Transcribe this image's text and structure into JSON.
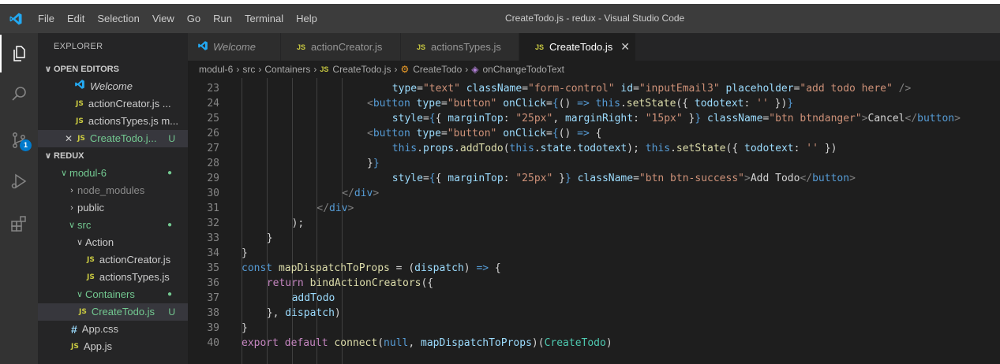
{
  "window": {
    "title": "CreateTodo.js - redux - Visual Studio Code",
    "menu": [
      "File",
      "Edit",
      "Selection",
      "View",
      "Go",
      "Run",
      "Terminal",
      "Help"
    ]
  },
  "activity_bar": {
    "items": [
      "explorer-icon",
      "search-icon",
      "source-control-icon",
      "run-debug-icon",
      "extensions-icon"
    ],
    "scm_badge": "1"
  },
  "sidebar": {
    "title": "EXPLORER",
    "open_editors_label": "OPEN EDITORS",
    "open_editors": [
      {
        "label": "Welcome"
      },
      {
        "label": "actionCreator.js ..."
      },
      {
        "label": "actionsTypes.js m..."
      },
      {
        "label": "CreateTodo.j...",
        "status": "U"
      }
    ],
    "project_label": "REDUX",
    "tree": {
      "modul6": "modul-6",
      "node_modules": "node_modules",
      "public": "public",
      "src": "src",
      "action": "Action",
      "action_creator": "actionCreator.js",
      "actions_types": "actionsTypes.js",
      "containers": "Containers",
      "create_todo": "CreateTodo.js",
      "create_todo_status": "U",
      "app_css": "App.css",
      "app_js": "App.js"
    }
  },
  "tabs": [
    {
      "label": "Welcome"
    },
    {
      "label": "actionCreator.js"
    },
    {
      "label": "actionsTypes.js"
    },
    {
      "label": "CreateTodo.js"
    }
  ],
  "breadcrumb": [
    "modul-6",
    "src",
    "Containers",
    "CreateTodo.js",
    "CreateTodo",
    "onChangeTodoText"
  ],
  "editor": {
    "lines": [
      {
        "n": "23",
        "indent": 24,
        "tokens": [
          [
            "attr",
            "type"
          ],
          [
            "txt",
            "="
          ],
          [
            "str",
            "\"text\""
          ],
          [
            "txt",
            " "
          ],
          [
            "attr",
            "className"
          ],
          [
            "txt",
            "="
          ],
          [
            "str",
            "\"form-control\""
          ],
          [
            "txt",
            " "
          ],
          [
            "attr",
            "id"
          ],
          [
            "txt",
            "="
          ],
          [
            "str",
            "\"inputEmail3\""
          ],
          [
            "txt",
            " "
          ],
          [
            "attr",
            "placeholder"
          ],
          [
            "txt",
            "="
          ],
          [
            "str",
            "\"add todo here\""
          ],
          [
            "txt",
            " "
          ],
          [
            "tag",
            "/>"
          ]
        ]
      },
      {
        "n": "24",
        "indent": 20,
        "tokens": [
          [
            "tag",
            "<"
          ],
          [
            "tn",
            "button"
          ],
          [
            "txt",
            " "
          ],
          [
            "attr",
            "type"
          ],
          [
            "txt",
            "="
          ],
          [
            "str",
            "\"button\""
          ],
          [
            "txt",
            " "
          ],
          [
            "attr",
            "onClick"
          ],
          [
            "txt",
            "="
          ],
          [
            "kw",
            "{"
          ],
          [
            "txt",
            "() "
          ],
          [
            "kw",
            "=>"
          ],
          [
            "txt",
            " "
          ],
          [
            "kw",
            "this"
          ],
          [
            "txt",
            "."
          ],
          [
            "fn",
            "setState"
          ],
          [
            "txt",
            "({ "
          ],
          [
            "var",
            "todotext"
          ],
          [
            "txt",
            ": "
          ],
          [
            "str",
            "''"
          ],
          [
            "txt",
            " })"
          ],
          [
            "kw",
            "}"
          ]
        ]
      },
      {
        "n": "25",
        "indent": 24,
        "tokens": [
          [
            "attr",
            "style"
          ],
          [
            "txt",
            "="
          ],
          [
            "kw",
            "{"
          ],
          [
            "txt",
            "{ "
          ],
          [
            "var",
            "marginTop"
          ],
          [
            "txt",
            ": "
          ],
          [
            "str",
            "\"25px\""
          ],
          [
            "txt",
            ", "
          ],
          [
            "var",
            "marginRight"
          ],
          [
            "txt",
            ": "
          ],
          [
            "str",
            "\"15px\""
          ],
          [
            "txt",
            " }"
          ],
          [
            "kw",
            "}"
          ],
          [
            "txt",
            " "
          ],
          [
            "attr",
            "className"
          ],
          [
            "txt",
            "="
          ],
          [
            "str",
            "\"btn btndanger\""
          ],
          [
            "tag",
            ">"
          ],
          [
            "txt",
            "Cancel"
          ],
          [
            "tag",
            "</"
          ],
          [
            "tn",
            "button"
          ],
          [
            "tag",
            ">"
          ]
        ]
      },
      {
        "n": "26",
        "indent": 20,
        "tokens": [
          [
            "tag",
            "<"
          ],
          [
            "tn",
            "button"
          ],
          [
            "txt",
            " "
          ],
          [
            "attr",
            "type"
          ],
          [
            "txt",
            "="
          ],
          [
            "str",
            "\"button\""
          ],
          [
            "txt",
            " "
          ],
          [
            "attr",
            "onClick"
          ],
          [
            "txt",
            "="
          ],
          [
            "kw",
            "{"
          ],
          [
            "txt",
            "() "
          ],
          [
            "kw",
            "=>"
          ],
          [
            "txt",
            " {"
          ]
        ]
      },
      {
        "n": "27",
        "indent": 24,
        "tokens": [
          [
            "kw",
            "this"
          ],
          [
            "txt",
            "."
          ],
          [
            "var",
            "props"
          ],
          [
            "txt",
            "."
          ],
          [
            "fn",
            "addTodo"
          ],
          [
            "txt",
            "("
          ],
          [
            "kw",
            "this"
          ],
          [
            "txt",
            "."
          ],
          [
            "var",
            "state"
          ],
          [
            "txt",
            "."
          ],
          [
            "var",
            "todotext"
          ],
          [
            "txt",
            "); "
          ],
          [
            "kw",
            "this"
          ],
          [
            "txt",
            "."
          ],
          [
            "fn",
            "setState"
          ],
          [
            "txt",
            "({ "
          ],
          [
            "var",
            "todotext"
          ],
          [
            "txt",
            ": "
          ],
          [
            "str",
            "''"
          ],
          [
            "txt",
            " })"
          ]
        ]
      },
      {
        "n": "28",
        "indent": 20,
        "tokens": [
          [
            "txt",
            "}"
          ],
          [
            "kw",
            "}"
          ]
        ]
      },
      {
        "n": "29",
        "indent": 24,
        "tokens": [
          [
            "attr",
            "style"
          ],
          [
            "txt",
            "="
          ],
          [
            "kw",
            "{"
          ],
          [
            "txt",
            "{ "
          ],
          [
            "var",
            "marginTop"
          ],
          [
            "txt",
            ": "
          ],
          [
            "str",
            "\"25px\""
          ],
          [
            "txt",
            " }"
          ],
          [
            "kw",
            "}"
          ],
          [
            "txt",
            " "
          ],
          [
            "attr",
            "className"
          ],
          [
            "txt",
            "="
          ],
          [
            "str",
            "\"btn btn-success\""
          ],
          [
            "tag",
            ">"
          ],
          [
            "txt",
            "Add Todo"
          ],
          [
            "tag",
            "</"
          ],
          [
            "tn",
            "button"
          ],
          [
            "tag",
            ">"
          ]
        ]
      },
      {
        "n": "30",
        "indent": 16,
        "tokens": [
          [
            "tag",
            "</"
          ],
          [
            "tn",
            "div"
          ],
          [
            "tag",
            ">"
          ]
        ]
      },
      {
        "n": "31",
        "indent": 12,
        "tokens": [
          [
            "tag",
            "</"
          ],
          [
            "tn",
            "div"
          ],
          [
            "tag",
            ">"
          ]
        ]
      },
      {
        "n": "32",
        "indent": 8,
        "tokens": [
          [
            "txt",
            ");"
          ]
        ]
      },
      {
        "n": "33",
        "indent": 4,
        "tokens": [
          [
            "txt",
            "}"
          ]
        ]
      },
      {
        "n": "34",
        "indent": 0,
        "tokens": [
          [
            "txt",
            "}"
          ]
        ]
      },
      {
        "n": "35",
        "indent": 0,
        "tokens": [
          [
            "kw",
            "const"
          ],
          [
            "txt",
            " "
          ],
          [
            "fn",
            "mapDispatchToProps"
          ],
          [
            "txt",
            " = ("
          ],
          [
            "var",
            "dispatch"
          ],
          [
            "txt",
            ") "
          ],
          [
            "kw",
            "=>"
          ],
          [
            "txt",
            " {"
          ]
        ]
      },
      {
        "n": "36",
        "indent": 4,
        "tokens": [
          [
            "ctl",
            "return"
          ],
          [
            "txt",
            " "
          ],
          [
            "fn",
            "bindActionCreators"
          ],
          [
            "txt",
            "({"
          ]
        ]
      },
      {
        "n": "37",
        "indent": 8,
        "tokens": [
          [
            "var",
            "addTodo"
          ]
        ]
      },
      {
        "n": "38",
        "indent": 4,
        "tokens": [
          [
            "txt",
            "}, "
          ],
          [
            "var",
            "dispatch"
          ],
          [
            "txt",
            ")"
          ]
        ]
      },
      {
        "n": "39",
        "indent": 0,
        "tokens": [
          [
            "txt",
            "}"
          ]
        ]
      },
      {
        "n": "40",
        "indent": 0,
        "tokens": [
          [
            "ctl",
            "export"
          ],
          [
            "txt",
            " "
          ],
          [
            "ctl",
            "default"
          ],
          [
            "txt",
            " "
          ],
          [
            "fn",
            "connect"
          ],
          [
            "txt",
            "("
          ],
          [
            "kw",
            "null"
          ],
          [
            "txt",
            ", "
          ],
          [
            "var",
            "mapDispatchToProps"
          ],
          [
            "txt",
            ")("
          ],
          [
            "cls",
            "CreateTodo"
          ],
          [
            "txt",
            ")"
          ]
        ]
      }
    ]
  },
  "colors": {
    "accent": "#007acc",
    "titlebar": "#3c3c3c",
    "sidebar": "#252526",
    "editor_bg": "#1e1e1e",
    "untracked": "#73c991",
    "js_icon": "#cbcb41"
  }
}
